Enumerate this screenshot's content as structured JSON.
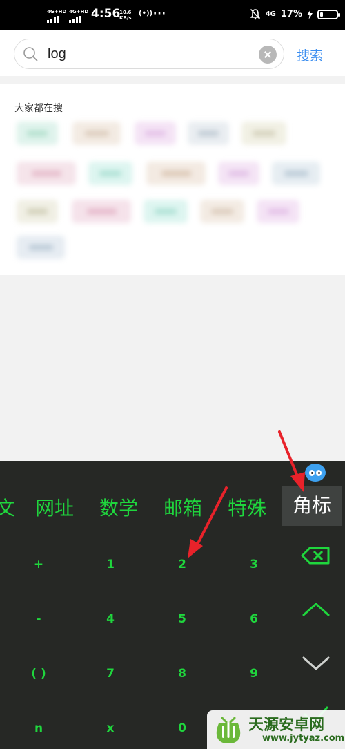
{
  "status_bar": {
    "signal1": "4G+HD",
    "signal2": "4G+HD",
    "time": "4:56",
    "speed_value": "10.6",
    "speed_unit": "KB/s",
    "hotspot": "(•))",
    "more": "···",
    "network": "4G",
    "battery": "17%"
  },
  "search": {
    "query": "log",
    "button_label": "搜索"
  },
  "trending": {
    "title": "大家都在搜"
  },
  "keyboard": {
    "tabs": [
      "文",
      "网址",
      "数学",
      "邮箱",
      "特殊",
      "角标"
    ],
    "active_tab": "角标",
    "keys": [
      [
        "+",
        "1",
        "2",
        "3"
      ],
      [
        "-",
        "4",
        "5",
        "6"
      ],
      [
        "( )",
        "7",
        "8",
        "9"
      ],
      [
        "n",
        "x",
        "0",
        ""
      ]
    ]
  },
  "watermark": {
    "title": "天源安卓网",
    "url": "www.jytyaz.com"
  },
  "colors": {
    "keyboard_bg": "#262825",
    "key_green": "#1fd63d",
    "link_blue": "#3b8ef0",
    "arrow_red": "#e8222a"
  }
}
